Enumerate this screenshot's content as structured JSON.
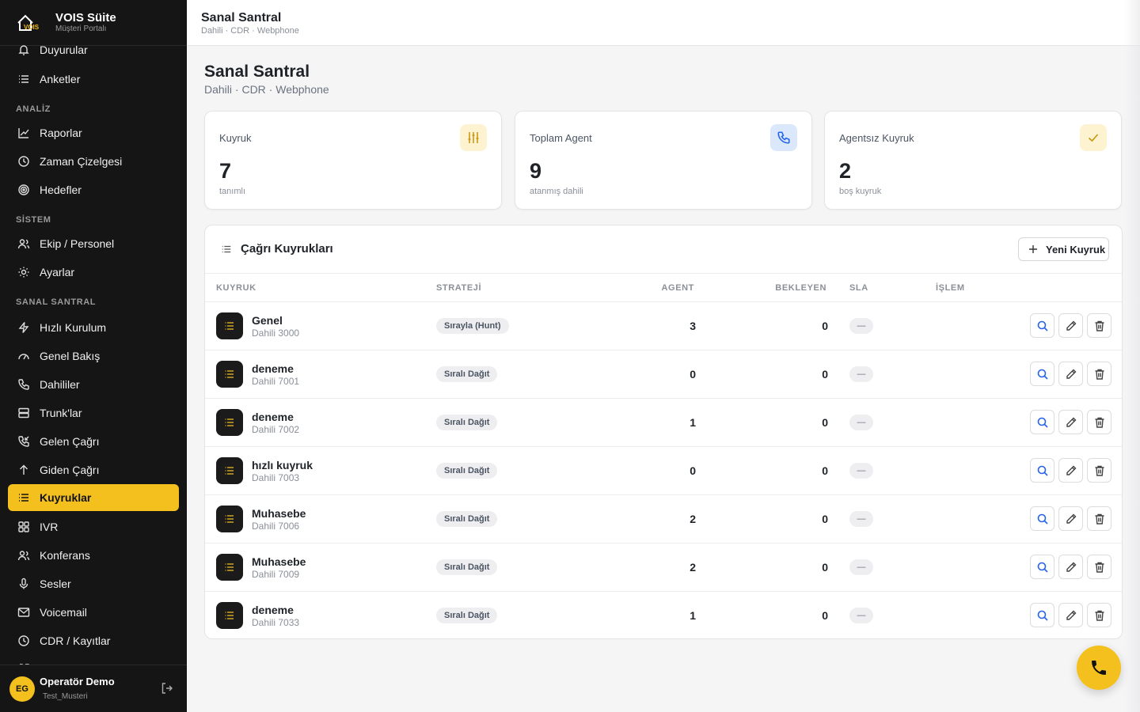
{
  "brand": {
    "name": "VOIS Süite",
    "subtitle": "Müşteri Portalı",
    "logo_text": "VOIS"
  },
  "topbar": {
    "title": "Sanal Santral",
    "crumbs": "Dahili · CDR · Webphone"
  },
  "sidebar": {
    "items": [
      {
        "label": "Duyurular",
        "icon": "bell-icon"
      },
      {
        "label": "Anketler",
        "icon": "list-icon"
      },
      {
        "label": "Raporlar",
        "icon": "chart-icon"
      },
      {
        "label": "Zaman Çizelgesi",
        "icon": "clock-icon"
      },
      {
        "label": "Hedefler",
        "icon": "target-icon"
      },
      {
        "label": "Ekip / Personel",
        "icon": "users-icon"
      },
      {
        "label": "Ayarlar",
        "icon": "sun-icon"
      },
      {
        "label": "Hızlı Kurulum",
        "icon": "bolt-icon"
      },
      {
        "label": "Genel Bakış",
        "icon": "gauge-icon"
      },
      {
        "label": "Dahililer",
        "icon": "phone-icon"
      },
      {
        "label": "Trunk'lar",
        "icon": "server-icon"
      },
      {
        "label": "Gelen Çağrı",
        "icon": "phone-incoming-icon"
      },
      {
        "label": "Giden Çağrı",
        "icon": "arrow-up-icon"
      },
      {
        "label": "Kuyruklar",
        "icon": "list-icon",
        "active": true
      },
      {
        "label": "IVR",
        "icon": "grid-icon"
      },
      {
        "label": "Konferans",
        "icon": "users-icon"
      },
      {
        "label": "Sesler",
        "icon": "mic-icon"
      },
      {
        "label": "Voicemail",
        "icon": "mail-icon"
      },
      {
        "label": "CDR / Kayıtlar",
        "icon": "clock-icon"
      }
    ],
    "sections": {
      "analiz": "ANALİZ",
      "sistem": "SİSTEM",
      "santral": "SANAL SANTRAL"
    }
  },
  "user": {
    "initials": "EG",
    "name": "Operatör Demo",
    "org": "Test_Musteri"
  },
  "page": {
    "title": "Sanal Santral",
    "subtitle": "Dahili · CDR · Webphone"
  },
  "stats": [
    {
      "label": "Kuyruk",
      "value": "7",
      "sub": "tanımlı",
      "icon": "sliders-icon"
    },
    {
      "label": "Toplam Agent",
      "value": "9",
      "sub": "atanmış dahili",
      "icon": "phone-icon"
    },
    {
      "label": "Agentsız Kuyruk",
      "value": "2",
      "sub": "boş kuyruk",
      "icon": "check-icon"
    }
  ],
  "queues": {
    "title": "Çağrı Kuyrukları",
    "new_button": "Yeni Kuyruk",
    "columns": [
      "KUYRUK",
      "STRATEJİ",
      "AGENT",
      "BEKLEYEN",
      "SLA",
      "İŞLEM"
    ],
    "rows": [
      {
        "name": "Genel",
        "ext": "Dahili 3000",
        "strategy": "Sırayla (Hunt)",
        "agents": "3",
        "waiting": "0",
        "sla": "—"
      },
      {
        "name": "deneme",
        "ext": "Dahili 7001",
        "strategy": "Sıralı Dağıt",
        "agents": "0",
        "waiting": "0",
        "sla": "—"
      },
      {
        "name": "deneme",
        "ext": "Dahili 7002",
        "strategy": "Sıralı Dağıt",
        "agents": "1",
        "waiting": "0",
        "sla": "—"
      },
      {
        "name": "hızlı kuyruk",
        "ext": "Dahili 7003",
        "strategy": "Sıralı Dağıt",
        "agents": "0",
        "waiting": "0",
        "sla": "—"
      },
      {
        "name": "Muhasebe",
        "ext": "Dahili 7006",
        "strategy": "Sıralı Dağıt",
        "agents": "2",
        "waiting": "0",
        "sla": "—"
      },
      {
        "name": "Muhasebe",
        "ext": "Dahili 7009",
        "strategy": "Sıralı Dağıt",
        "agents": "2",
        "waiting": "0",
        "sla": "—"
      },
      {
        "name": "deneme",
        "ext": "Dahili 7033",
        "strategy": "Sıralı Dağıt",
        "agents": "1",
        "waiting": "0",
        "sla": "—"
      }
    ]
  },
  "colors": {
    "accent": "#f4c01e",
    "sidebar_bg": "#151515",
    "blue_icon": "#2563eb"
  }
}
